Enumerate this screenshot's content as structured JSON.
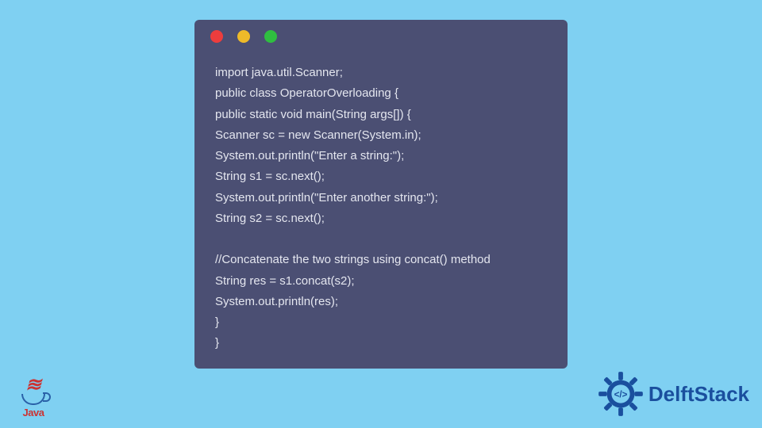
{
  "code_lines": [
    "import java.util.Scanner;",
    "public class OperatorOverloading {",
    "public static void main(String args[]) {",
    "Scanner sc = new Scanner(System.in);",
    "System.out.println(\"Enter a string:\");",
    "String s1 = sc.next();",
    "System.out.println(\"Enter another string:\");",
    "String s2 = sc.next();",
    "",
    "//Concatenate the two strings using concat() method",
    "String res = s1.concat(s2);",
    "System.out.println(res);",
    "}",
    "}"
  ],
  "java_logo": {
    "word": "Java"
  },
  "delft": {
    "text": "DelftStack"
  }
}
